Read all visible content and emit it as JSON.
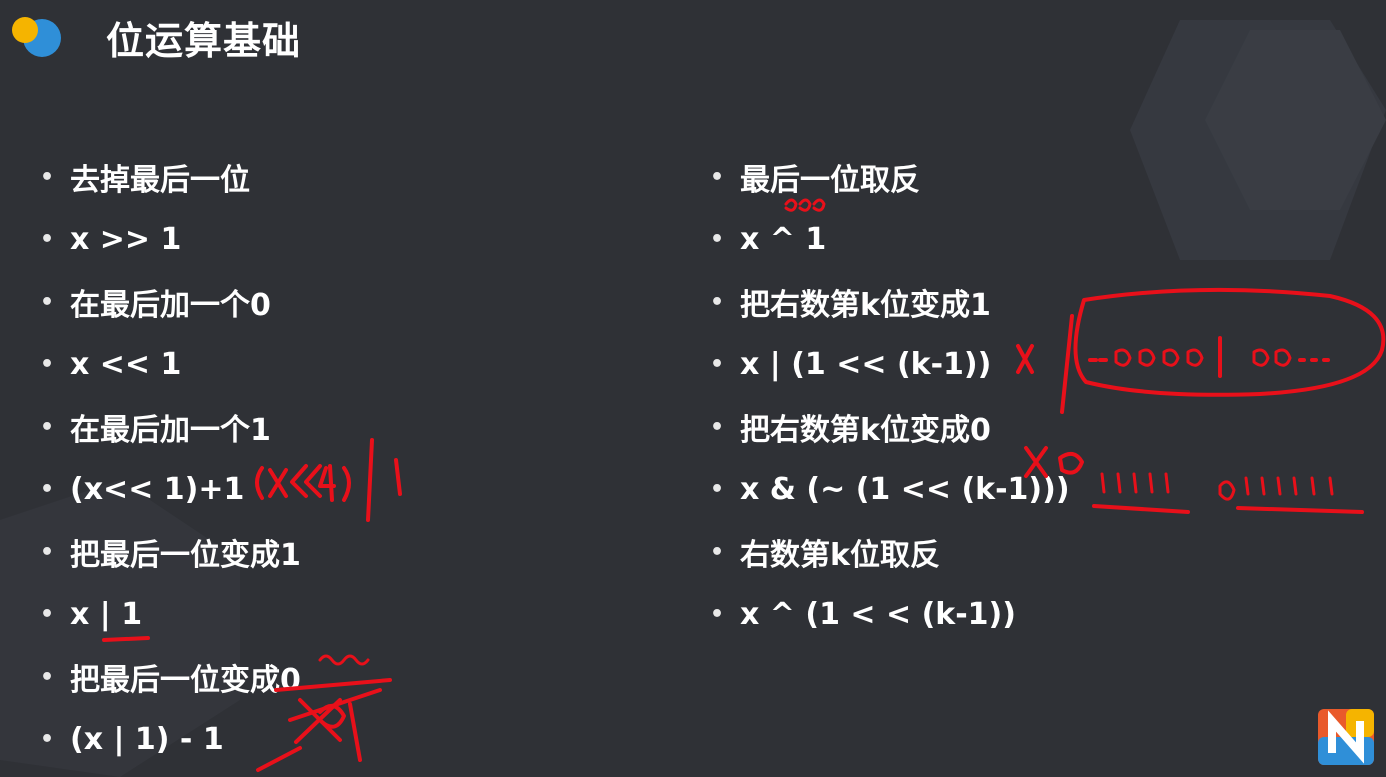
{
  "title": "位运算基础",
  "left_items": [
    "去掉最后一位",
    "x >> 1",
    "在最后加一个0",
    "x << 1",
    "在最后加一个1",
    "(x<< 1)+1",
    "把最后一位变成1",
    "x | 1",
    "把最后一位变成0",
    "(x | 1) - 1"
  ],
  "right_items": [
    "最后一位取反",
    "x ^ 1",
    "把右数第k位变成1",
    "x | (1 << (k-1))",
    "把右数第k位变成0",
    "x & (~ (1 << (k-1)))",
    "右数第k位取反",
    "x ^ (1 < < (k-1))"
  ],
  "colors": {
    "background": "#2f3136",
    "text": "#ffffff",
    "handwriting": "#e8101a",
    "logo_yellow": "#f5b400",
    "logo_blue": "#2f8fd8"
  },
  "icons": {
    "logo": "yellow-blue-dots-icon",
    "brand": "n-badge-icon"
  }
}
